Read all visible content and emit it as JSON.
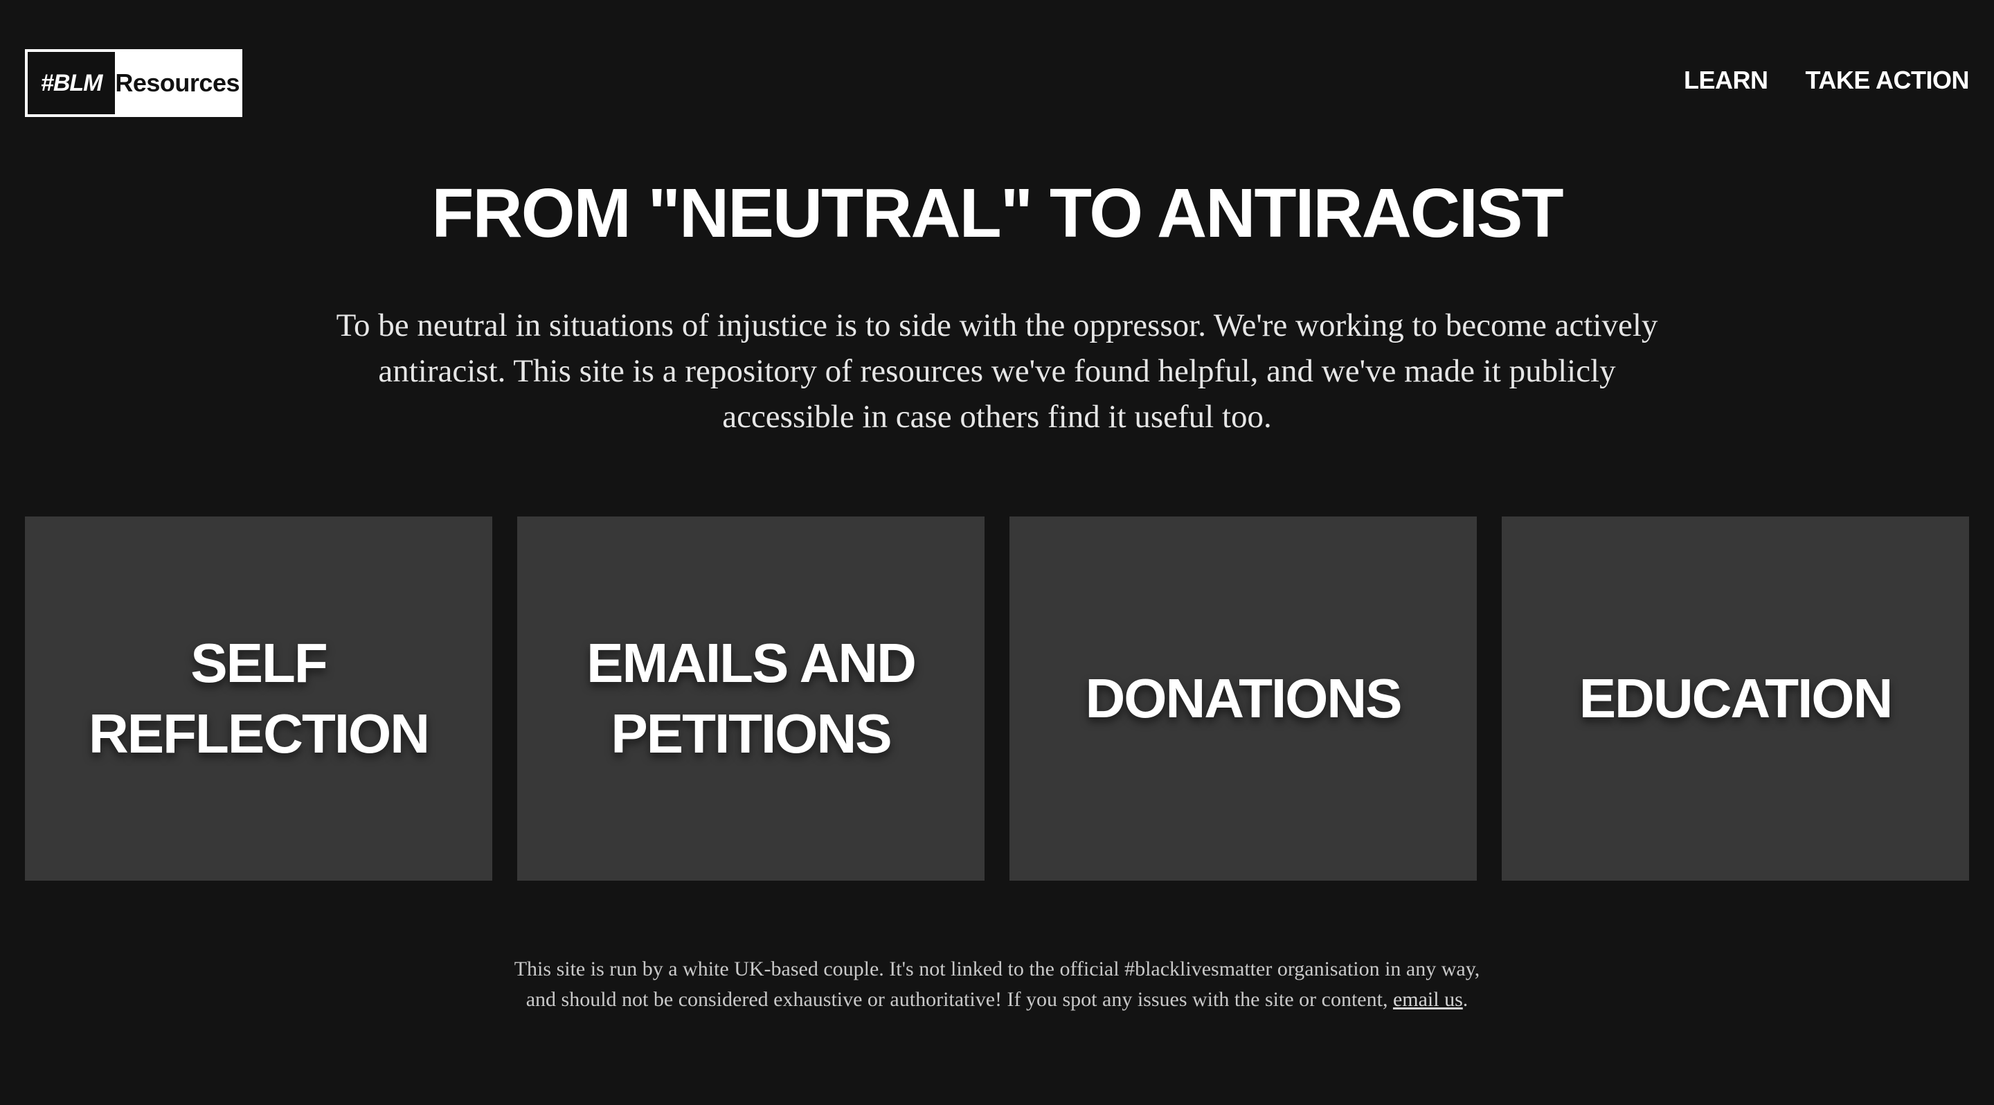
{
  "header": {
    "logo_tag": "#BLM",
    "logo_name": "Resources",
    "nav": [
      "LEARN",
      "TAKE ACTION"
    ]
  },
  "hero": {
    "title": "FROM \"NEUTRAL\" TO ANTIRACIST",
    "description": "To be neutral in situations of injustice is to side with the oppressor. We're working to become actively antiracist. This site is a repository of resources we've found helpful, and we've made it publicly accessible in case others find it useful too."
  },
  "cards": [
    {
      "label": "SELF REFLECTION"
    },
    {
      "label": "EMAILS AND PETITIONS"
    },
    {
      "label": "DONATIONS"
    },
    {
      "label": "EDUCATION"
    }
  ],
  "footer": {
    "line1": "This site is run by a white UK-based couple. It's not linked to the official #blacklivesmatter organisation in any way,",
    "line2_before_link": "and should not be considered exhaustive or authoritative! If you spot any issues with the site or content, ",
    "link_text": "email us",
    "line2_after_link": "."
  },
  "colors": {
    "background": "#131313",
    "card_background": "#383838",
    "text": "#ffffff"
  }
}
